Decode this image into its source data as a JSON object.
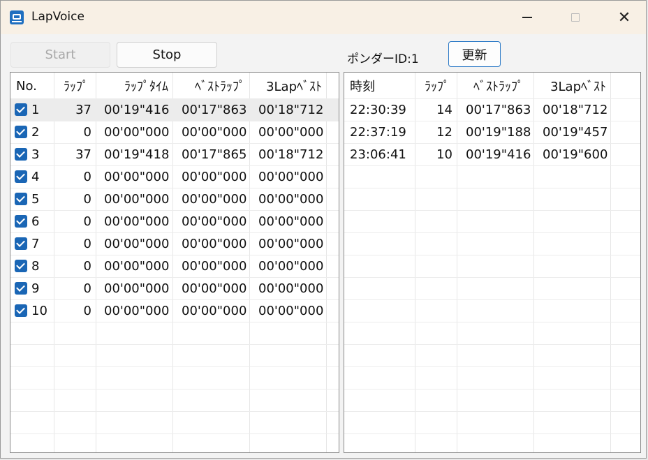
{
  "window": {
    "title": "LapVoice"
  },
  "titlebar": {
    "close": "✕"
  },
  "toolbar": {
    "start_label": "Start",
    "stop_label": "Stop",
    "ponder_label": "ポンダーID:1",
    "refresh_label": "更新"
  },
  "left_table": {
    "headers": [
      "No.",
      "ﾗｯﾌﾟ",
      "ﾗｯﾌﾟﾀｲﾑ",
      "ﾍﾞｽﾄﾗｯﾌﾟ",
      "3Lapﾍﾞｽﾄ"
    ],
    "rows": [
      {
        "no": "1",
        "checked": true,
        "lap": "37",
        "lap_time": "00'19\"416",
        "best_lap": "00'17\"863",
        "best3": "00'18\"712"
      },
      {
        "no": "2",
        "checked": true,
        "lap": "0",
        "lap_time": "00'00\"000",
        "best_lap": "00'00\"000",
        "best3": "00'00\"000"
      },
      {
        "no": "3",
        "checked": true,
        "lap": "37",
        "lap_time": "00'19\"418",
        "best_lap": "00'17\"865",
        "best3": "00'18\"712"
      },
      {
        "no": "4",
        "checked": true,
        "lap": "0",
        "lap_time": "00'00\"000",
        "best_lap": "00'00\"000",
        "best3": "00'00\"000"
      },
      {
        "no": "5",
        "checked": true,
        "lap": "0",
        "lap_time": "00'00\"000",
        "best_lap": "00'00\"000",
        "best3": "00'00\"000"
      },
      {
        "no": "6",
        "checked": true,
        "lap": "0",
        "lap_time": "00'00\"000",
        "best_lap": "00'00\"000",
        "best3": "00'00\"000"
      },
      {
        "no": "7",
        "checked": true,
        "lap": "0",
        "lap_time": "00'00\"000",
        "best_lap": "00'00\"000",
        "best3": "00'00\"000"
      },
      {
        "no": "8",
        "checked": true,
        "lap": "0",
        "lap_time": "00'00\"000",
        "best_lap": "00'00\"000",
        "best3": "00'00\"000"
      },
      {
        "no": "9",
        "checked": true,
        "lap": "0",
        "lap_time": "00'00\"000",
        "best_lap": "00'00\"000",
        "best3": "00'00\"000"
      },
      {
        "no": "10",
        "checked": true,
        "lap": "0",
        "lap_time": "00'00\"000",
        "best_lap": "00'00\"000",
        "best3": "00'00\"000"
      }
    ]
  },
  "right_table": {
    "headers": [
      "時刻",
      "ﾗｯﾌﾟ",
      "ﾍﾞｽﾄﾗｯﾌﾟ",
      "3Lapﾍﾞｽﾄ"
    ],
    "rows": [
      {
        "time": "22:30:39",
        "lap": "14",
        "best_lap": "00'17\"863",
        "best3": "00'18\"712"
      },
      {
        "time": "22:37:19",
        "lap": "12",
        "best_lap": "00'19\"188",
        "best3": "00'19\"457"
      },
      {
        "time": "23:06:41",
        "lap": "10",
        "best_lap": "00'19\"416",
        "best3": "00'19\"600"
      }
    ]
  },
  "colors": {
    "titlebar_bg": "#f8f0e5",
    "accent": "#1a66b5",
    "selected_row": "#ececec"
  },
  "icons": {
    "app": "lapvoice-app-icon",
    "minimize": "minimize-icon",
    "maximize": "maximize-icon",
    "close": "close-icon",
    "check": "checkbox-checked-icon"
  }
}
